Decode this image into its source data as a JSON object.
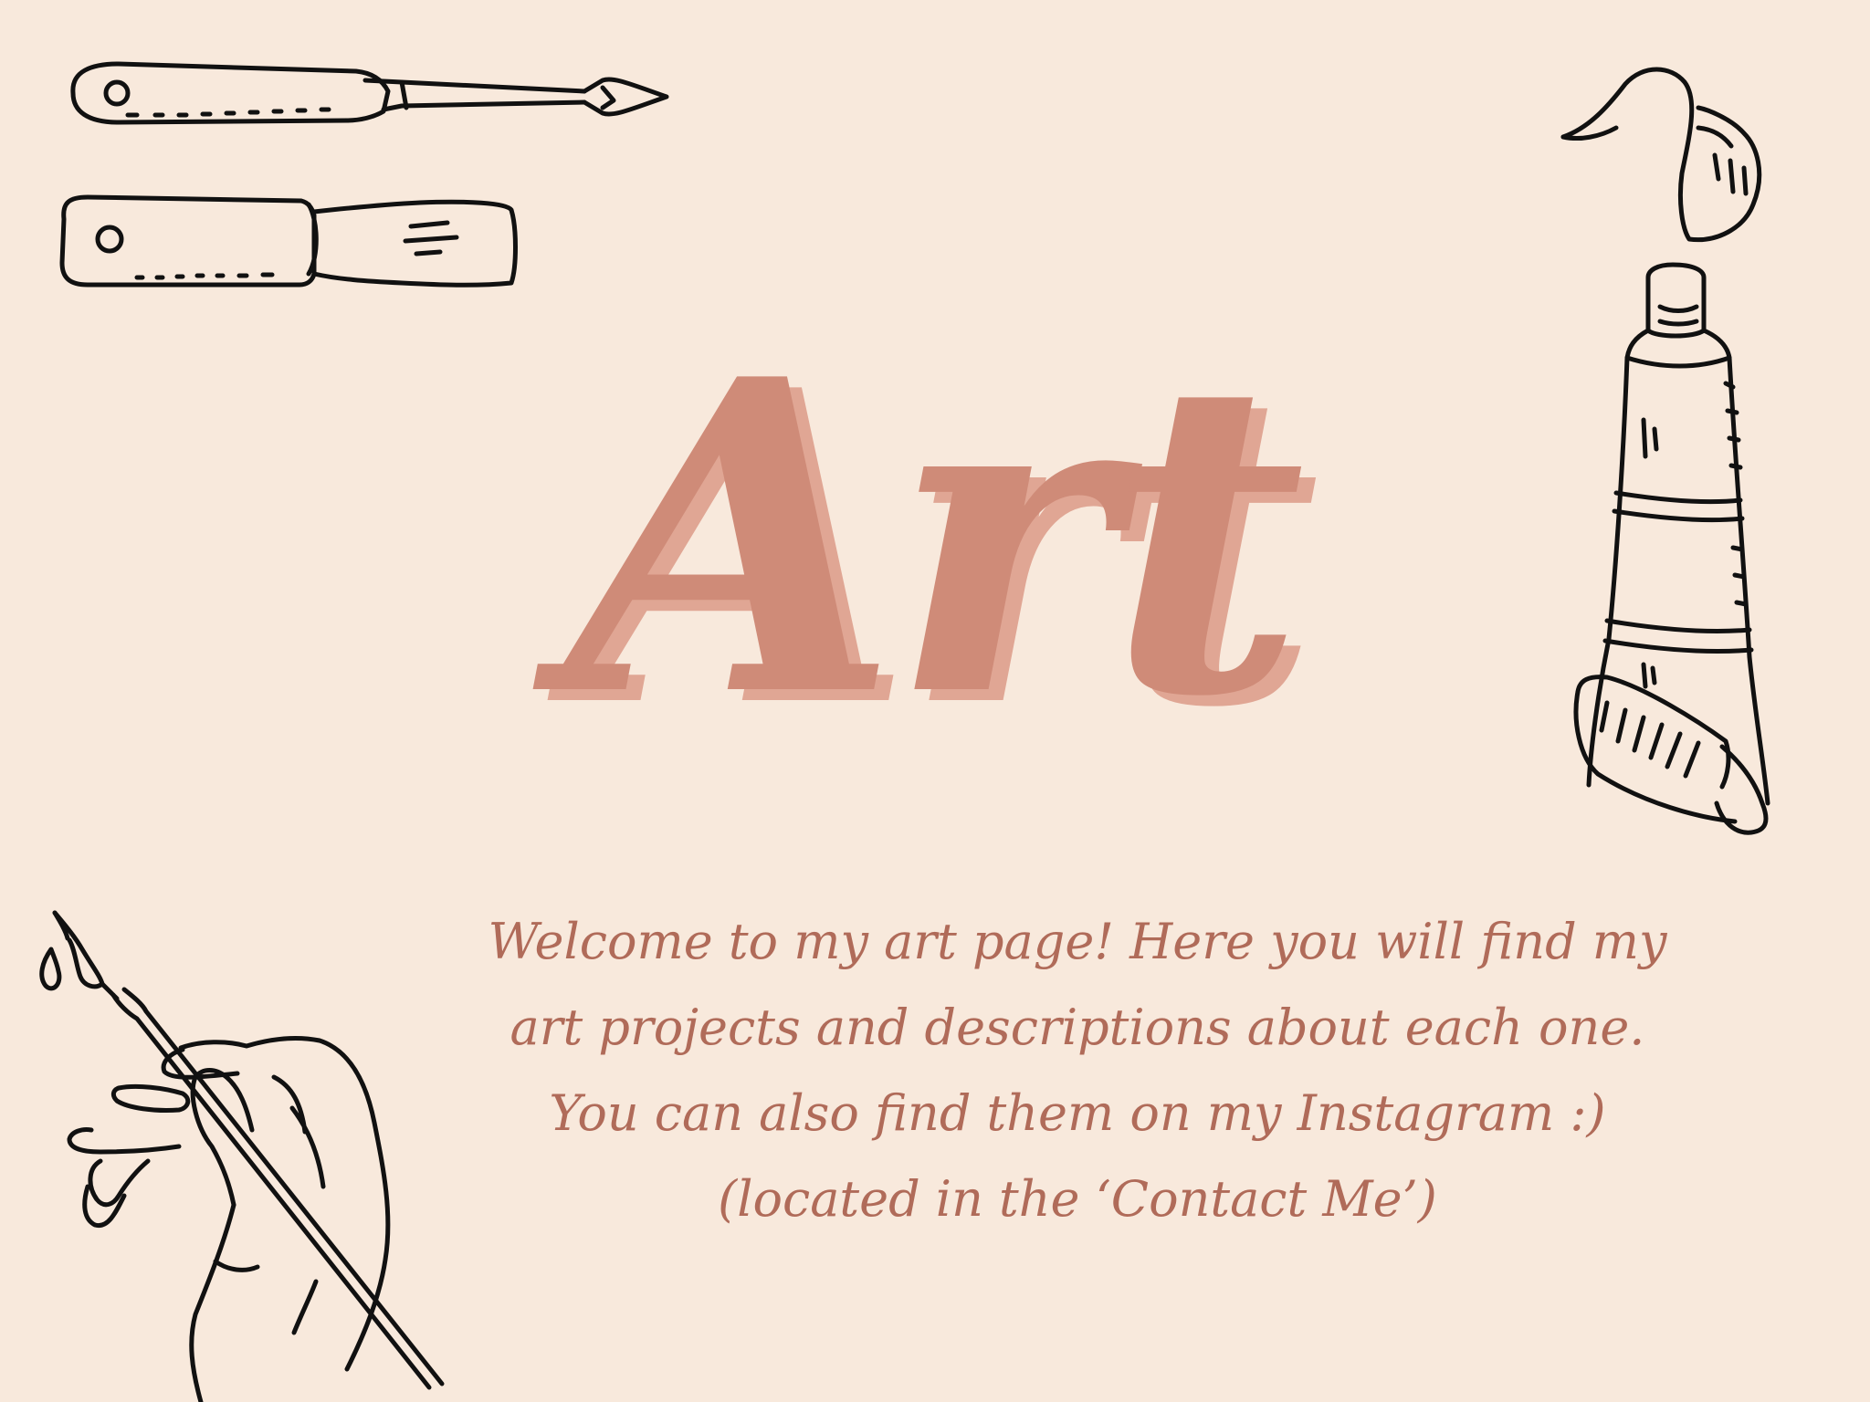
{
  "page": {
    "title": "Art",
    "welcome_text": "Welcome to my art page! Here you will find my art projects and descriptions about each one. You can also find them on my Instagram :)  (located in the ‘Contact Me’)"
  },
  "colors": {
    "background": "#f8e9dc",
    "title": "#cf8b78",
    "title_shadow": "#e0a694",
    "text": "#b06b59",
    "line_art": "#111111"
  },
  "illustrations": [
    "palette-knife-icon",
    "paint-scraper-icon",
    "paint-tube-icon",
    "hand-with-paintbrush-icon"
  ]
}
